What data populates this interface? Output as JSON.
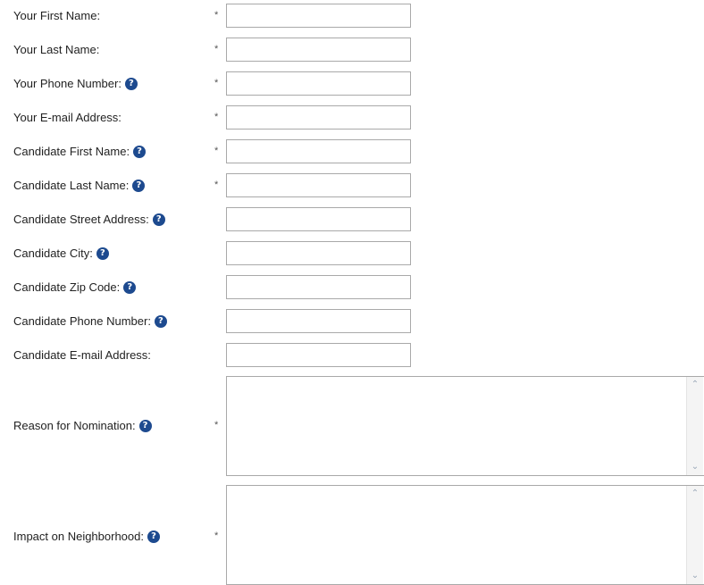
{
  "required_marker": "*",
  "help_icon_glyph": "?",
  "scroll_up_glyph": "⌃",
  "scroll_down_glyph": "⌄",
  "fields": {
    "your_first_name": {
      "label": "Your First Name:",
      "value": "",
      "required": true
    },
    "your_last_name": {
      "label": "Your Last Name:",
      "value": "",
      "required": true
    },
    "your_phone": {
      "label": "Your Phone Number:",
      "value": "",
      "required": true,
      "help": true
    },
    "your_email": {
      "label": "Your E-mail Address:",
      "value": "",
      "required": true
    },
    "cand_first_name": {
      "label": "Candidate First Name:",
      "value": "",
      "required": true,
      "help": true
    },
    "cand_last_name": {
      "label": "Candidate Last Name:",
      "value": "",
      "required": true,
      "help": true
    },
    "cand_street": {
      "label": "Candidate Street Address:",
      "value": "",
      "required": false,
      "help": true
    },
    "cand_city": {
      "label": "Candidate City:",
      "value": "",
      "required": false,
      "help": true
    },
    "cand_zip": {
      "label": "Candidate Zip Code:",
      "value": "",
      "required": false,
      "help": true
    },
    "cand_phone": {
      "label": "Candidate Phone Number:",
      "value": "",
      "required": false,
      "help": true
    },
    "cand_email": {
      "label": "Candidate E-mail Address:",
      "value": "",
      "required": false
    },
    "reason": {
      "label": "Reason for Nomination:",
      "value": "",
      "required": true,
      "help": true
    },
    "impact": {
      "label": "Impact on Neighborhood:",
      "value": "",
      "required": true,
      "help": true
    }
  },
  "colors": {
    "help_icon_bg": "#1d4a8f",
    "input_border": "#a9a9a9"
  }
}
